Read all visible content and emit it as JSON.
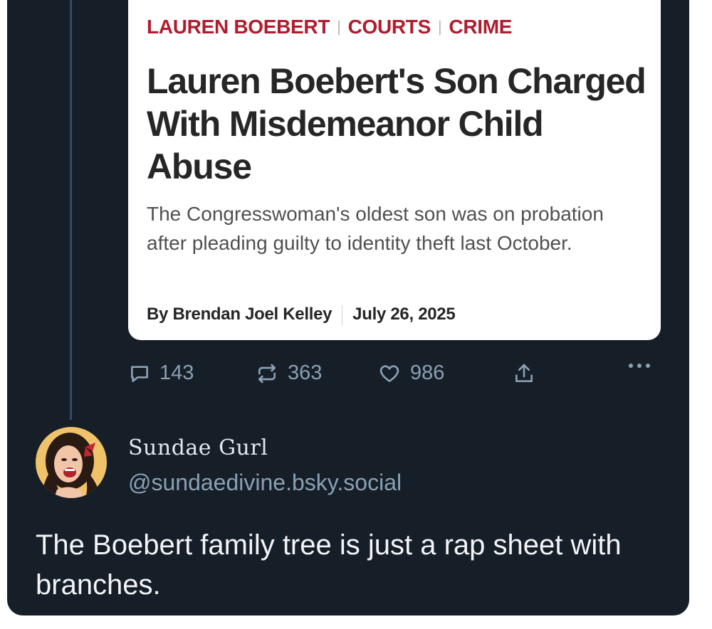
{
  "article": {
    "tags": [
      "LAUREN BOEBERT",
      "COURTS",
      "CRIME"
    ],
    "headline": "Lauren Boebert's Son Charged With Misdemeanor Child Abuse",
    "dek": "The Congresswoman's oldest son was on probation after pleading guilty to identity theft last October.",
    "author": "By Brendan Joel Kelley",
    "date": "July 26, 2025"
  },
  "actions": {
    "replies": "143",
    "reposts": "363",
    "likes": "986"
  },
  "post": {
    "display_name": "Sundae Gurl",
    "handle": "@sundaedivine.bsky.social",
    "text": "The Boebert family tree is just a rap sheet with branches."
  },
  "colors": {
    "background": "#161e28",
    "tag_red": "#b01c2e",
    "muted": "#8aa0b3"
  }
}
